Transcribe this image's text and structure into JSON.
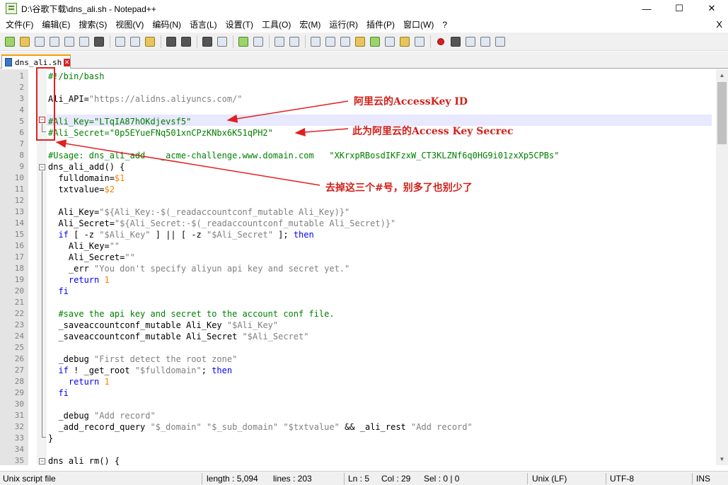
{
  "window": {
    "title": "D:\\谷歌下载\\dns_ali.sh - Notepad++",
    "minimize_label": "—",
    "maximize_label": "☐",
    "close_label": "✕"
  },
  "menu": {
    "items": [
      "文件(F)",
      "编辑(E)",
      "搜索(S)",
      "视图(V)",
      "编码(N)",
      "语言(L)",
      "设置(T)",
      "工具(O)",
      "宏(M)",
      "运行(R)",
      "插件(P)",
      "窗口(W)",
      "?"
    ],
    "close_label": "X"
  },
  "toolbar": {
    "icons": [
      "new-file-icon",
      "open-file-icon",
      "save-icon",
      "save-all-icon",
      "close-icon",
      "close-all-icon",
      "print-icon",
      "cut-icon",
      "copy-icon",
      "paste-icon",
      "undo-icon",
      "redo-icon",
      "find-icon",
      "replace-icon",
      "zoom-in-icon",
      "zoom-out-icon",
      "sync-v-icon",
      "sync-h-icon",
      "word-wrap-icon",
      "all-chars-icon",
      "indent-guide-icon",
      "user-lang-icon",
      "doc-map-icon",
      "function-list-icon",
      "folder-workspace-icon",
      "monitor-icon",
      "record-macro-icon",
      "stop-macro-icon",
      "play-macro-icon",
      "run-macro-multiple-icon",
      "save-macro-icon"
    ]
  },
  "tab": {
    "label": "dns_ali.sh",
    "close_label": "✕"
  },
  "editor": {
    "line_numbers": [
      "1",
      "2",
      "3",
      "4",
      "5",
      "6",
      "7",
      "8",
      "9",
      "10",
      "11",
      "12",
      "13",
      "14",
      "15",
      "16",
      "17",
      "18",
      "19",
      "20",
      "21",
      "22",
      "23",
      "24",
      "25",
      "26",
      "27",
      "28",
      "29",
      "30",
      "31",
      "32",
      "33",
      "34",
      "35"
    ],
    "lines": [
      [
        {
          "t": "#!/bin/bash",
          "c": "cmt"
        }
      ],
      [],
      [
        {
          "t": "Ali_API=",
          "c": "txt"
        },
        {
          "t": "\"https://alidns.aliyuncs.com/\"",
          "c": "str"
        }
      ],
      [],
      [
        {
          "t": "#Ali_Key=\"LTqIA87hOKdjevsf5\"",
          "c": "cmt"
        }
      ],
      [
        {
          "t": "#Ali_Secret=\"0p5EYueFNq501xnCPzKNbx6K51qPH2\"",
          "c": "cmt"
        }
      ],
      [],
      [
        {
          "t": "#Usage: dns_ali_add   _acme-challenge.www.domain.com   \"XKrxpRBosdIKFzxW_CT3KLZNf6q0HG9i01zxXp5CPBs\"",
          "c": "cmt"
        }
      ],
      [
        {
          "t": "dns_ali_add() {",
          "c": "txt"
        }
      ],
      [
        {
          "t": "  fulldomain=",
          "c": "txt"
        },
        {
          "t": "$1",
          "c": "var"
        }
      ],
      [
        {
          "t": "  txtvalue=",
          "c": "txt"
        },
        {
          "t": "$2",
          "c": "var"
        }
      ],
      [],
      [
        {
          "t": "  Ali_Key=",
          "c": "txt"
        },
        {
          "t": "\"${Ali_Key:-$(_readaccountconf_mutable Ali_Key)}\"",
          "c": "str"
        }
      ],
      [
        {
          "t": "  Ali_Secret=",
          "c": "txt"
        },
        {
          "t": "\"${Ali_Secret:-$(_readaccountconf_mutable Ali_Secret)}\"",
          "c": "str"
        }
      ],
      [
        {
          "t": "  if",
          "c": "kw"
        },
        {
          "t": " [ -z ",
          "c": "txt"
        },
        {
          "t": "\"$Ali_Key\"",
          "c": "str"
        },
        {
          "t": " ] || [ -z ",
          "c": "txt"
        },
        {
          "t": "\"$Ali_Secret\"",
          "c": "str"
        },
        {
          "t": " ]; ",
          "c": "txt"
        },
        {
          "t": "then",
          "c": "kw"
        }
      ],
      [
        {
          "t": "    Ali_Key=",
          "c": "txt"
        },
        {
          "t": "\"\"",
          "c": "str"
        }
      ],
      [
        {
          "t": "    Ali_Secret=",
          "c": "txt"
        },
        {
          "t": "\"\"",
          "c": "str"
        }
      ],
      [
        {
          "t": "    _err ",
          "c": "txt"
        },
        {
          "t": "\"You don't specify aliyun api key and secret yet.\"",
          "c": "str"
        }
      ],
      [
        {
          "t": "    return",
          "c": "kw"
        },
        {
          "t": " 1",
          "c": "var"
        }
      ],
      [
        {
          "t": "  fi",
          "c": "kw"
        }
      ],
      [],
      [
        {
          "t": "  #save the api key and secret to the account conf file.",
          "c": "cmt"
        }
      ],
      [
        {
          "t": "  _saveaccountconf_mutable Ali_Key ",
          "c": "txt"
        },
        {
          "t": "\"$Ali_Key\"",
          "c": "str"
        }
      ],
      [
        {
          "t": "  _saveaccountconf_mutable Ali_Secret ",
          "c": "txt"
        },
        {
          "t": "\"$Ali_Secret\"",
          "c": "str"
        }
      ],
      [],
      [
        {
          "t": "  _debug ",
          "c": "txt"
        },
        {
          "t": "\"First detect the root zone\"",
          "c": "str"
        }
      ],
      [
        {
          "t": "  if",
          "c": "kw"
        },
        {
          "t": " ! _get_root ",
          "c": "txt"
        },
        {
          "t": "\"$fulldomain\"",
          "c": "str"
        },
        {
          "t": "; ",
          "c": "txt"
        },
        {
          "t": "then",
          "c": "kw"
        }
      ],
      [
        {
          "t": "    return",
          "c": "kw"
        },
        {
          "t": " 1",
          "c": "var"
        }
      ],
      [
        {
          "t": "  fi",
          "c": "kw"
        }
      ],
      [],
      [
        {
          "t": "  _debug ",
          "c": "txt"
        },
        {
          "t": "\"Add record\"",
          "c": "str"
        }
      ],
      [
        {
          "t": "  _add_record_query ",
          "c": "txt"
        },
        {
          "t": "\"$_domain\"",
          "c": "str"
        },
        {
          "t": " ",
          "c": "txt"
        },
        {
          "t": "\"$_sub_domain\"",
          "c": "str"
        },
        {
          "t": " ",
          "c": "txt"
        },
        {
          "t": "\"$txtvalue\"",
          "c": "str"
        },
        {
          "t": " && _ali_rest ",
          "c": "txt"
        },
        {
          "t": "\"Add record\"",
          "c": "str"
        }
      ],
      [
        {
          "t": "}",
          "c": "txt"
        }
      ],
      [],
      [
        {
          "t": "dns_ali_rm() {",
          "c": "txt"
        }
      ]
    ]
  },
  "annotations": {
    "access_key_id": "阿里云的AccessKey ID",
    "access_key_secret": "此为阿里云的Access Key Secrec",
    "remove_hash": "去掉这三个#号，别多了也别少了"
  },
  "statusbar": {
    "file_type": "Unix script file",
    "length": "length : 5,094",
    "lines": "lines : 203",
    "ln": "Ln : 5",
    "col": "Col : 29",
    "sel": "Sel : 0 | 0",
    "eol": "Unix (LF)",
    "encoding": "UTF-8",
    "mode": "INS"
  },
  "colors": {
    "comment": "#008000",
    "keyword": "#0000ff",
    "string": "#808080",
    "variable": "#ff8000",
    "annotation": "#d0201a",
    "current_line": "#e8e8ff"
  }
}
